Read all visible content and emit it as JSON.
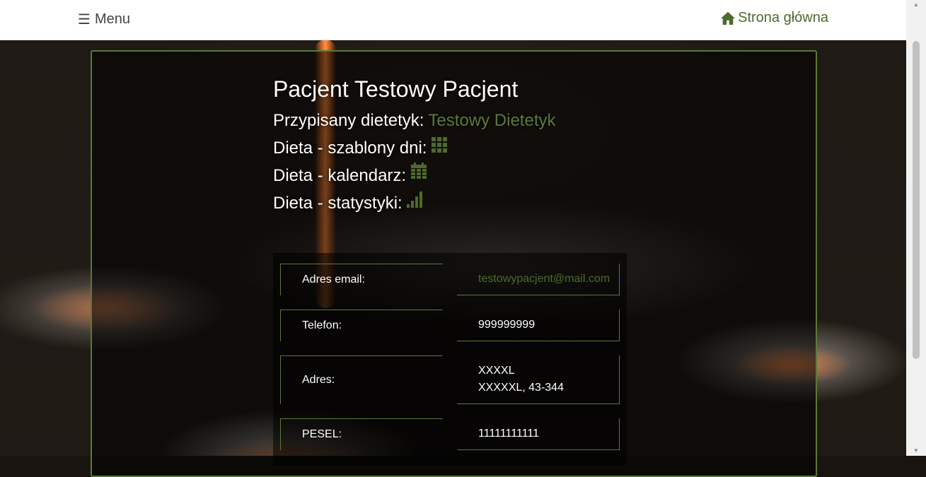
{
  "navbar": {
    "menu_label": "Menu",
    "home_label": "Strona główna",
    "accent": "#4d6a2c"
  },
  "patient": {
    "title": "Pacjent Testowy Pacjent",
    "dietitian_label": "Przypisany dietetyk:",
    "dietitian_name": "Testowy Dietetyk",
    "templates_label": "Dieta - szablony dni:",
    "templates_icon": "grid-icon",
    "calendar_label": "Dieta - kalendarz:",
    "calendar_icon": "calendar-icon",
    "stats_label": "Dieta - statystyki:",
    "stats_icon": "signal-bars-icon"
  },
  "info": {
    "rows": [
      {
        "label": "Adres email:",
        "value": [
          "testowypacjent@mail.com"
        ]
      },
      {
        "label": "Telefon:",
        "value": [
          "999999999"
        ]
      },
      {
        "label": "Adres:",
        "value": [
          "XXXXL",
          "XXXXXL, 43-344"
        ]
      },
      {
        "label": "PESEL:",
        "value": [
          "11111111111"
        ]
      }
    ]
  }
}
